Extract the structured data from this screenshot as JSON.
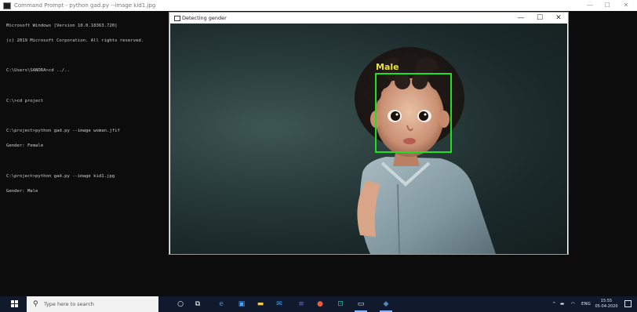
{
  "cmd_window": {
    "title": "Command Prompt - python gad.py --image kid1.jpg",
    "lines": [
      "Microsoft Windows [Version 10.0.18363.720]",
      "(c) 2019 Microsoft Corporation. All rights reserved.",
      "",
      "C:\\Users\\SANDRA>cd ../..",
      "",
      "C:\\>cd project",
      "",
      "C:\\project>python gad.py --image woman.jfif",
      "Gender: Female",
      "",
      "C:\\project>python gad.py --image kid1.jpg",
      "Gender: Male"
    ],
    "controls": {
      "minimize": "—",
      "maximize": "☐",
      "close": "✕"
    }
  },
  "gender_window": {
    "title": "Detecting gender",
    "controls": {
      "minimize": "—",
      "maximize": "☐",
      "close": "✕"
    },
    "detection": {
      "label": "Male",
      "box_color": "#1fe21f",
      "label_color": "#e8e23a"
    }
  },
  "taskbar": {
    "search_placeholder": "Type here to search",
    "pinned_icons": [
      "cortana-icon",
      "task-view-icon",
      "edge-icon",
      "store-icon",
      "file-explorer-icon",
      "mail-icon",
      "photos-icon",
      "chrome-icon",
      "vscode-icon",
      "cmd-icon",
      "python-icon"
    ],
    "tray": {
      "language": "ENG",
      "time": "15:55",
      "date": "05-04-2020"
    }
  }
}
